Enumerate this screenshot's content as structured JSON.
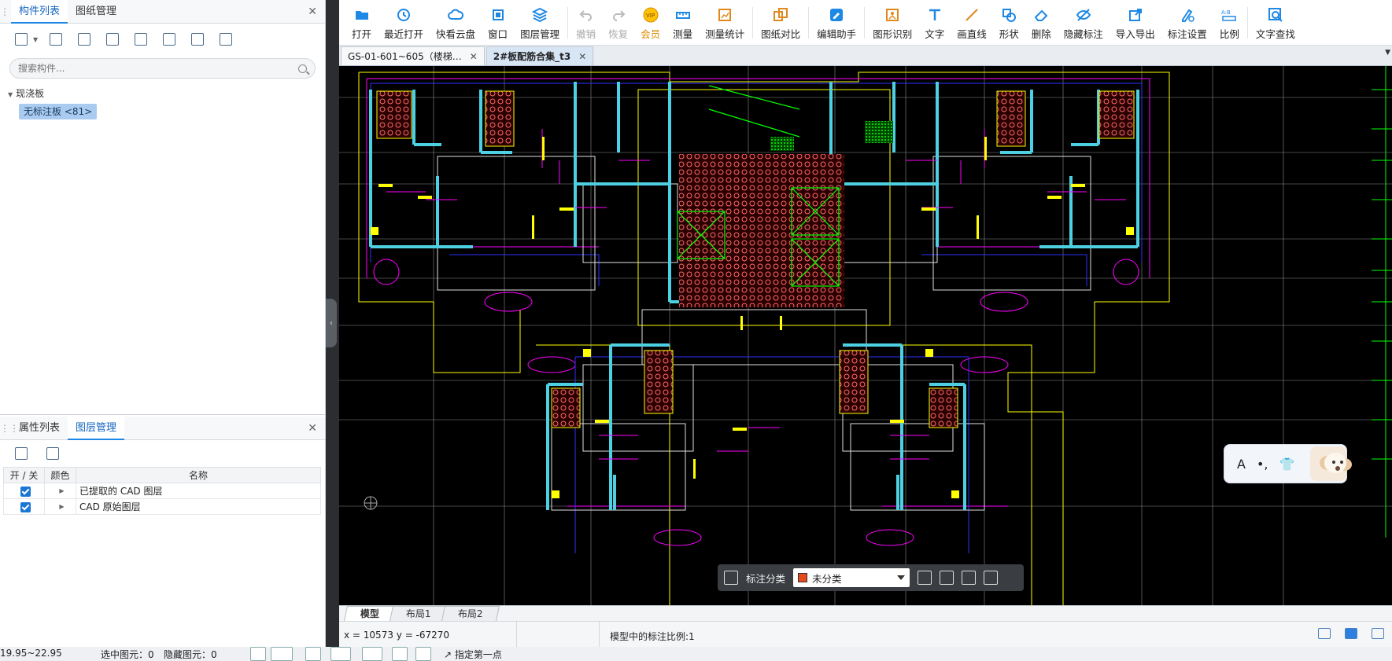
{
  "left_upper": {
    "tabs": [
      "构件列表",
      "图纸管理"
    ],
    "search_placeholder": "搜索构件...",
    "tree_root": "现浇板",
    "tree_leaf": "无标注板 <81>"
  },
  "left_lower": {
    "tabs": [
      "属性列表",
      "图层管理"
    ],
    "columns": [
      "开 / 关",
      "颜色",
      "名称"
    ],
    "rows": [
      {
        "name": "已提取的 CAD 图层",
        "checked": true
      },
      {
        "name": "CAD 原始图层",
        "checked": true
      }
    ]
  },
  "toolbar": {
    "items": [
      {
        "label": "打开",
        "icon": "folder-open-icon"
      },
      {
        "label": "最近打开",
        "icon": "clock-icon"
      },
      {
        "label": "快看云盘",
        "icon": "cloud-icon"
      },
      {
        "label": "窗口",
        "icon": "window-icon"
      },
      {
        "label": "图层管理",
        "icon": "layers-icon"
      },
      {
        "label": "撤销",
        "icon": "undo-icon"
      },
      {
        "label": "恢复",
        "icon": "redo-icon"
      },
      {
        "label": "会员",
        "icon": "vip-icon"
      },
      {
        "label": "测量",
        "icon": "measure-icon"
      },
      {
        "label": "测量统计",
        "icon": "measure-stats-icon"
      },
      {
        "label": "图纸对比",
        "icon": "compare-icon"
      },
      {
        "label": "编辑助手",
        "icon": "edit-assistant-icon"
      },
      {
        "label": "图形识别",
        "icon": "shape-recognize-icon"
      },
      {
        "label": "文字",
        "icon": "text-icon"
      },
      {
        "label": "画直线",
        "icon": "line-icon"
      },
      {
        "label": "形状",
        "icon": "shape-icon"
      },
      {
        "label": "删除",
        "icon": "eraser-icon"
      },
      {
        "label": "隐藏标注",
        "icon": "eye-hide-icon"
      },
      {
        "label": "导入导出",
        "icon": "import-export-icon"
      },
      {
        "label": "标注设置",
        "icon": "annotation-settings-icon"
      },
      {
        "label": "比例",
        "icon": "scale-icon"
      },
      {
        "label": "文字查找",
        "icon": "text-search-icon"
      }
    ],
    "scale_icon_text": "A:B"
  },
  "doc_tabs": [
    {
      "label": "GS-01-601~605（楼梯…",
      "active": false
    },
    {
      "label": "2#板配筋合集_t3",
      "active": true
    }
  ],
  "layout_tabs": [
    "模型",
    "布局1",
    "布局2"
  ],
  "status": {
    "coords": "x = 10573 y = -67270",
    "scale": "模型中的标注比例:1"
  },
  "floatbar": {
    "label": "标注分类",
    "selected": "未分类",
    "selected_color": "#e64a19"
  },
  "ime": {
    "a": "A",
    "dot": "•,",
    "shirt": "👕"
  },
  "global_status": {
    "range": "19.95~22.95",
    "selected": "选中图元：0",
    "hidden": "隐藏图元：0",
    "hint": "指定第一点"
  },
  "colors": {
    "accent": "#1e88e5",
    "canvas": "#000000",
    "cad_wall": "#4dd0e1",
    "cad_axis": "#ffffff",
    "cad_yellow": "#ffff00",
    "cad_magenta": "#ff00ff",
    "cad_green": "#00ff00",
    "cad_hatch": "#ff6b6b"
  }
}
